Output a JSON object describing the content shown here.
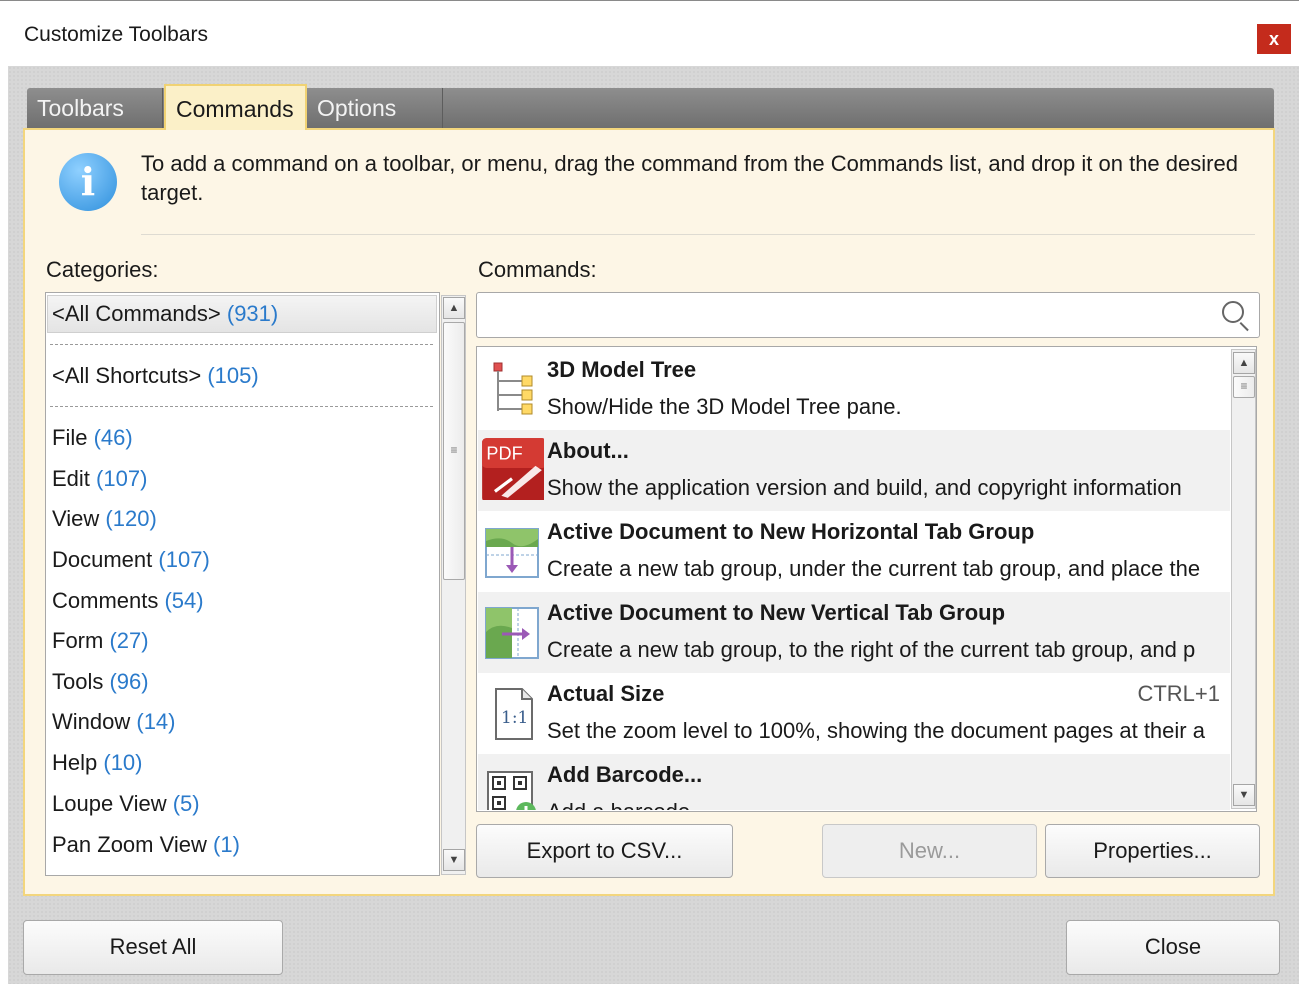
{
  "window": {
    "title": "Customize Toolbars",
    "close_glyph": "x"
  },
  "tabs": [
    {
      "label": "Toolbars",
      "active": false
    },
    {
      "label": "Commands",
      "active": true
    },
    {
      "label": "Options",
      "active": false
    }
  ],
  "info": {
    "icon": "info-icon",
    "text": "To add a command on a toolbar, or menu, drag the command from the Commands list, and drop it on the desired target."
  },
  "categories": {
    "label": "Categories:",
    "items": [
      {
        "name": "<All Commands>",
        "count": "(931)",
        "selected": true
      },
      {
        "name": "<All Shortcuts>",
        "count": "(105)"
      },
      {
        "name": "File",
        "count": "(46)"
      },
      {
        "name": "Edit",
        "count": "(107)"
      },
      {
        "name": "View",
        "count": "(120)"
      },
      {
        "name": "Document",
        "count": "(107)"
      },
      {
        "name": "Comments",
        "count": "(54)"
      },
      {
        "name": "Form",
        "count": "(27)"
      },
      {
        "name": "Tools",
        "count": "(96)"
      },
      {
        "name": "Window",
        "count": "(14)"
      },
      {
        "name": "Help",
        "count": "(10)"
      },
      {
        "name": "Loupe View",
        "count": "(5)"
      },
      {
        "name": "Pan Zoom View",
        "count": "(1)"
      }
    ]
  },
  "commands": {
    "label": "Commands:",
    "search": {
      "value": "",
      "placeholder": ""
    },
    "items": [
      {
        "title": "3D Model Tree",
        "desc": "Show/Hide the 3D Model Tree pane.",
        "shortcut": "",
        "icon": "model-tree-icon"
      },
      {
        "title": "About...",
        "desc": "Show the application version and build, and copyright information",
        "shortcut": "",
        "icon": "pdf-logo-icon"
      },
      {
        "title": "Active Document to New Horizontal Tab Group",
        "desc": "Create a new tab group, under the current tab group, and place the",
        "shortcut": "",
        "icon": "horizontal-tab-group-icon"
      },
      {
        "title": "Active Document to New Vertical Tab Group",
        "desc": "Create a new tab group, to the right of the current tab group, and p",
        "shortcut": "",
        "icon": "vertical-tab-group-icon"
      },
      {
        "title": "Actual Size",
        "desc": "Set the zoom level to 100%, showing the document pages at their a",
        "shortcut": "CTRL+1",
        "icon": "actual-size-icon"
      },
      {
        "title": "Add Barcode...",
        "desc": "Add a barcode",
        "shortcut": "",
        "icon": "barcode-icon"
      }
    ]
  },
  "buttons": {
    "export": "Export to CSV...",
    "new": "New...",
    "properties": "Properties...",
    "reset_all": "Reset All",
    "close": "Close"
  }
}
